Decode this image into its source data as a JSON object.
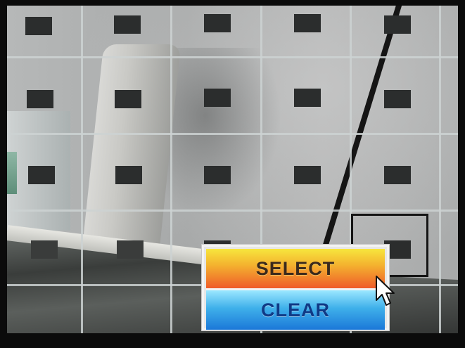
{
  "menu": {
    "items": [
      {
        "label": "SELECT",
        "active": true
      },
      {
        "label": "CLEAR",
        "active": false
      }
    ]
  },
  "colors": {
    "select_top": "#f7e63d",
    "select_bottom": "#ef5b2a",
    "clear_top": "#9be7ff",
    "clear_bottom": "#1b78d8",
    "grid_line": "#cdd2d2",
    "selection_border": "#141414"
  },
  "icons": {
    "cursor": "mouse-pointer-icon"
  }
}
